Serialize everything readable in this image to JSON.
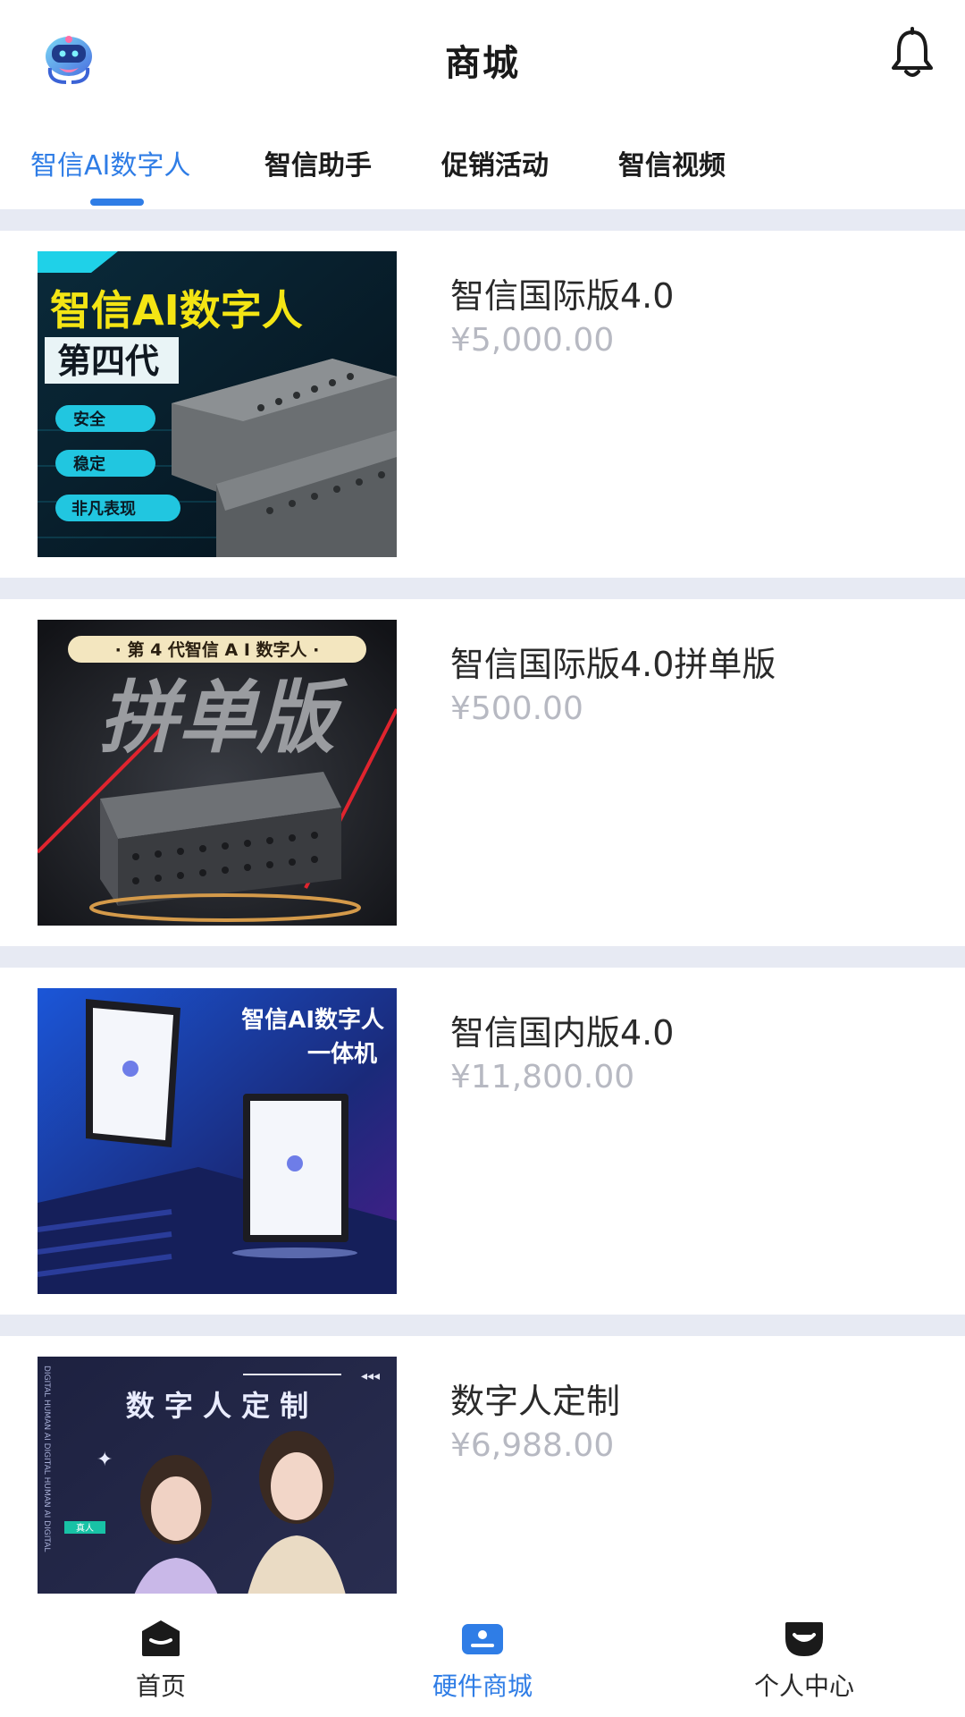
{
  "header": {
    "title": "商城",
    "logo_icon": "robot-mascot-icon",
    "notification_icon": "bell-icon"
  },
  "tabs": [
    {
      "label": "智信AI数字人",
      "active": true
    },
    {
      "label": "智信助手",
      "active": false
    },
    {
      "label": "促销活动",
      "active": false
    },
    {
      "label": "智信视频",
      "active": false
    }
  ],
  "products": [
    {
      "name": "智信国际版4.0",
      "price": "¥5,000.00",
      "image_text": {
        "headline": "智信AI数字人",
        "sub": "第四代",
        "tags": [
          "安全",
          "稳定",
          "非凡表现"
        ]
      }
    },
    {
      "name": "智信国际版4.0拼单版",
      "price": "¥500.00",
      "image_text": {
        "headline": "· 第 4 代智信 A I 数字人 ·",
        "sub": "拼单版"
      }
    },
    {
      "name": "智信国内版4.0",
      "price": "¥11,800.00",
      "image_text": {
        "headline": "智信AI数字人",
        "sub": "一体机"
      }
    },
    {
      "name": "数字人定制",
      "price": "¥6,988.00",
      "image_text": {
        "headline": "数 字 人 定 制",
        "side": "DIGITAL HUMAN AI DIGITAL HUMAN AI DIGITAL",
        "badge": "真人"
      }
    }
  ],
  "bottom_nav": [
    {
      "label": "首页",
      "icon": "home-icon",
      "active": false
    },
    {
      "label": "硬件商城",
      "icon": "store-icon",
      "active": true
    },
    {
      "label": "个人中心",
      "icon": "profile-icon",
      "active": false
    }
  ],
  "colors": {
    "accent": "#2f7de6",
    "price": "#b7b9c2",
    "divider": "#e7eaf3"
  }
}
